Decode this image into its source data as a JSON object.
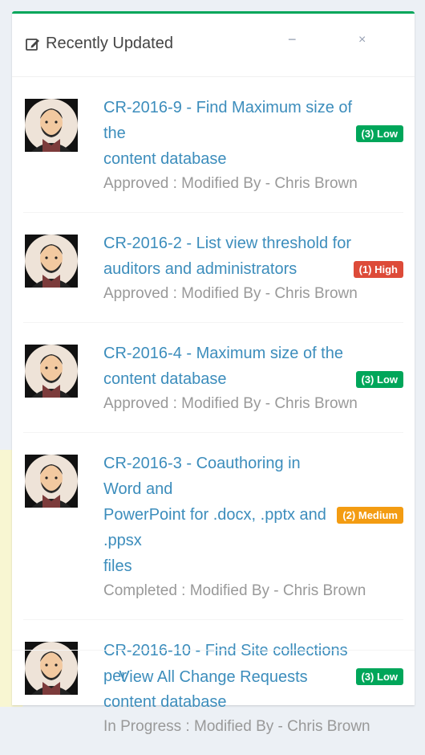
{
  "box": {
    "title": "Recently Updated",
    "minimize_label": "−",
    "close_label": "×"
  },
  "items": [
    {
      "title_line1": "CR-2016-9 - Find Maximum size of the",
      "title_line2": "content database",
      "priority": "(3) Low",
      "priority_level": "low",
      "status_text": "Approved : Modified By - Chris Brown"
    },
    {
      "title_line1": "CR-2016-2 - List view threshold for",
      "title_line2": "auditors and administrators",
      "priority": "(1) High",
      "priority_level": "high",
      "status_text": "Approved : Modified By - Chris Brown"
    },
    {
      "title_line1": "CR-2016-4 - Maximum size of the",
      "title_line2": "content database",
      "priority": "(3) Low",
      "priority_level": "low",
      "status_text": "Approved : Modified By - Chris Brown"
    },
    {
      "title_line1": "CR-2016-3 - Coauthoring in Word and",
      "title_line2": "PowerPoint for .docx, .pptx and .ppsx",
      "title_line3": "files",
      "priority": "(2) Medium",
      "priority_level": "medium",
      "status_text": "Completed : Modified By - Chris Brown"
    },
    {
      "title_line1": "CR-2016-10 - Find Site collections per",
      "title_line2": "content database",
      "priority": "(3) Low",
      "priority_level": "low",
      "status_text": "In Progress : Modified By - Chris Brown"
    }
  ],
  "footer": {
    "link_label": "View All Change Requests"
  },
  "colors": {
    "accent": "#00a65a",
    "link": "#3c8dbc",
    "low": "#00a65a",
    "high": "#dd4b39",
    "medium": "#f39c12"
  }
}
